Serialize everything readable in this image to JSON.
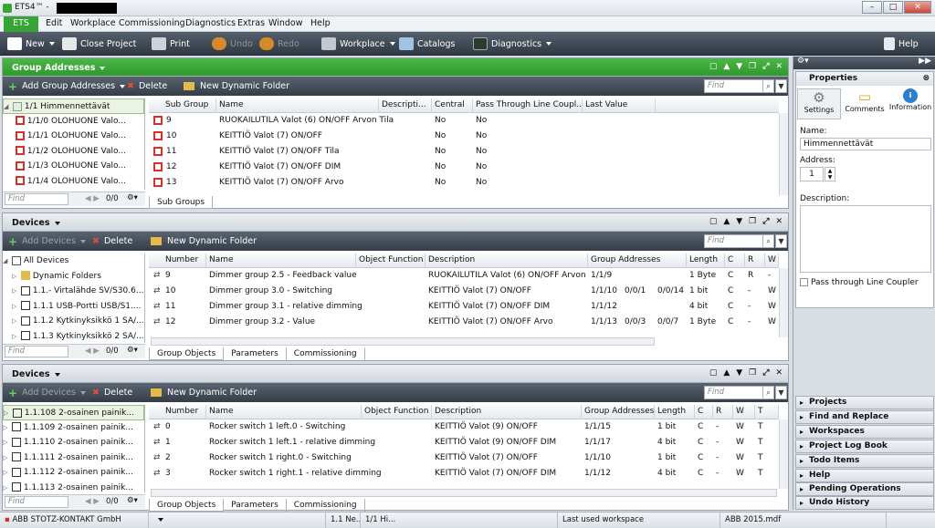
{
  "titlebar": {
    "title": "ETS4™ -"
  },
  "menu": {
    "ets": "ETS",
    "items": [
      "Edit",
      "Workplace",
      "Commissioning",
      "Diagnostics",
      "Extras",
      "Window",
      "Help"
    ]
  },
  "toolbar": {
    "new": "New",
    "close_project": "Close Project",
    "print": "Print",
    "undo": "Undo",
    "redo": "Redo",
    "workplace": "Workplace",
    "catalogs": "Catalogs",
    "diagnostics": "Diagnostics",
    "help": "Help"
  },
  "ga_panel": {
    "title": "Group Addresses",
    "add": "Add Group Addresses",
    "delete": "Delete",
    "new_folder": "New Dynamic Folder",
    "find": "Find",
    "tree": [
      "1/1 Himmennettävät",
      "1/1/0 OLOHUONE Valo...",
      "1/1/1 OLOHUONE Valo...",
      "1/1/2 OLOHUONE Valo...",
      "1/1/3 OLOHUONE Valo...",
      "1/1/4 OLOHUONE Valo..."
    ],
    "tree_find": "Find",
    "count": "0/0",
    "columns": [
      "Sub Group",
      "Name",
      "Descripti...",
      "Central",
      "Pass Through Line Coupl...",
      "Last Value"
    ],
    "rows": [
      {
        "sub": "9",
        "name": "RUOKAILUTILA Valot (6) ON/OFF Arvon Tila",
        "central": "No",
        "pass": "No"
      },
      {
        "sub": "10",
        "name": "KEITTIÖ Valot (7) ON/OFF",
        "central": "No",
        "pass": "No"
      },
      {
        "sub": "11",
        "name": "KEITTIÖ Valot (7) ON/OFF Tila",
        "central": "No",
        "pass": "No"
      },
      {
        "sub": "12",
        "name": "KEITTIÖ Valot (7) ON/OFF DIM",
        "central": "No",
        "pass": "No"
      },
      {
        "sub": "13",
        "name": "KEITTIÖ Valot (7) ON/OFF Arvo",
        "central": "No",
        "pass": "No"
      }
    ],
    "tabs": [
      "Sub Groups"
    ]
  },
  "dev_panel1": {
    "title": "Devices",
    "add": "Add Devices",
    "delete": "Delete",
    "new_folder": "New Dynamic Folder",
    "find": "Find",
    "tree": [
      "All Devices",
      "Dynamic Folders",
      "1.1.- Virtalähde SV/S30.6...",
      "1.1.1 USB-Portti USB/S1....",
      "1.1.2 Kytkinyksikkö 1 SA/...",
      "1.1.3 Kytkinyksikkö 2 SA/..."
    ],
    "tree_find": "Find",
    "count": "0/0",
    "columns": [
      "Number",
      "Name",
      "Object Function",
      "Description",
      "Group Addresses",
      "Length",
      "C",
      "R",
      "W"
    ],
    "rows": [
      {
        "num": "9",
        "name": "Dimmer group 2.5 - Feedback value",
        "desc": "RUOKAILUTILA Valot (6) ON/OFF Arvon Tila",
        "ga": "1/1/9",
        "ga2": "",
        "ga3": "",
        "len": "1 Byte",
        "c": "C",
        "r": "R",
        "w": "-"
      },
      {
        "num": "10",
        "name": "Dimmer group 3.0 - Switching",
        "desc": "KEITTIÖ Valot (7) ON/OFF",
        "ga": "1/1/10",
        "ga2": "0/0/1",
        "ga3": "0/0/14",
        "len": "1 bit",
        "c": "C",
        "r": "-",
        "w": "W"
      },
      {
        "num": "11",
        "name": "Dimmer group 3.1 - relative dimming",
        "desc": "KEITTIÖ Valot (7) ON/OFF DIM",
        "ga": "1/1/12",
        "ga2": "",
        "ga3": "",
        "len": "4 bit",
        "c": "C",
        "r": "-",
        "w": "W"
      },
      {
        "num": "12",
        "name": "Dimmer group 3.2 - Value",
        "desc": "KEITTIÖ Valot (7) ON/OFF Arvo",
        "ga": "1/1/13",
        "ga2": "0/0/3",
        "ga3": "0/0/7",
        "len": "1 Byte",
        "c": "C",
        "r": "-",
        "w": "W"
      }
    ],
    "tabs": [
      "Group Objects",
      "Parameters",
      "Commissioning"
    ]
  },
  "dev_panel2": {
    "title": "Devices",
    "add": "Add Devices",
    "delete": "Delete",
    "new_folder": "New Dynamic Folder",
    "find": "Find",
    "tree": [
      "1.1.108 2-osainen painik...",
      "1.1.109 2-osainen painik...",
      "1.1.110 2-osainen painik...",
      "1.1.111 2-osainen painik...",
      "1.1.112 2-osainen painik...",
      "1.1.113 2-osainen painik..."
    ],
    "tree_find": "Find",
    "count": "0/0",
    "columns": [
      "Number",
      "Name",
      "Object Function",
      "Description",
      "Group Addresses",
      "Length",
      "C",
      "R",
      "W",
      "T"
    ],
    "rows": [
      {
        "num": "0",
        "name": "Rocker switch 1 left.0 - Switching",
        "desc": "KEITTIÖ Valot (9) ON/OFF",
        "ga": "1/1/15",
        "len": "1 bit",
        "c": "C",
        "r": "-",
        "w": "W",
        "t": "T"
      },
      {
        "num": "1",
        "name": "Rocker switch 1 left.1 - relative dimming",
        "desc": "KEITTIÖ Valot (9) ON/OFF DIM",
        "ga": "1/1/17",
        "len": "4 bit",
        "c": "C",
        "r": "-",
        "w": "W",
        "t": "T"
      },
      {
        "num": "2",
        "name": "Rocker switch 1 right.0 - Switching",
        "desc": "KEITTIÖ Valot (7) ON/OFF",
        "ga": "1/1/10",
        "len": "1 bit",
        "c": "C",
        "r": "-",
        "w": "W",
        "t": "T"
      },
      {
        "num": "3",
        "name": "Rocker switch 1 right.1 - relative dimming",
        "desc": "KEITTIÖ Valot (7) ON/OFF DIM",
        "ga": "1/1/12",
        "len": "4 bit",
        "c": "C",
        "r": "-",
        "w": "W",
        "t": "T"
      }
    ],
    "tabs": [
      "Group Objects",
      "Parameters",
      "Commissioning"
    ]
  },
  "properties": {
    "title": "Properties",
    "tabs": [
      "Settings",
      "Comments",
      "Information"
    ],
    "name_label": "Name:",
    "name_value": "Himmennettävät",
    "address_label": "Address:",
    "address_value": "1",
    "description_label": "Description:",
    "pass_through": "Pass through Line Coupler"
  },
  "accordion": [
    "Projects",
    "Find and Replace",
    "Workspaces",
    "Project Log Book",
    "Todo Items",
    "Help",
    "Pending Operations",
    "Undo History"
  ],
  "statusbar": {
    "company": "ABB STOTZ-KONTAKT GmbH",
    "cell1": "1.1 Ne...",
    "cell2": "1/1 Hi...",
    "workspace": "Last used workspace",
    "file": "ABB 2015.mdf"
  },
  "colors": {
    "green": "#37a535",
    "toolbar": "#3a434e"
  }
}
